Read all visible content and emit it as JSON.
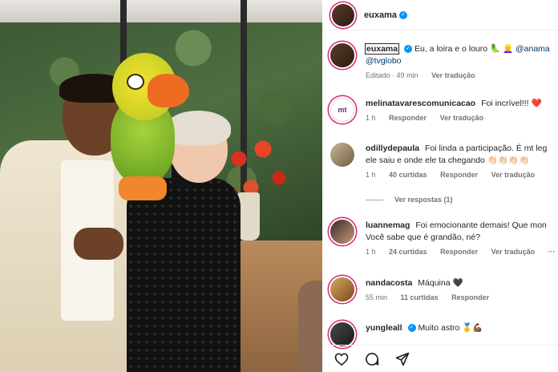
{
  "post": {
    "author": "euxama",
    "verified": true
  },
  "caption": {
    "username": "euxama",
    "text": "Eu, a loira e o louro 🦜 👱‍♀️",
    "mention_1": "@anama",
    "mention_2": "@tvglobo",
    "edited": "Editado · 49 min",
    "translate": "Ver tradução"
  },
  "comments": [
    {
      "username": "melinatavarescomunicacao",
      "text": "Foi incrível!!! ❤️",
      "time": "1 h",
      "reply": "Responder",
      "translate": "Ver tradução",
      "avatar_text": "mt"
    },
    {
      "username": "odillydepaula",
      "text_line1": "Foi linda a participação. É mt leg",
      "text_line2": "ele saiu e onde ele ta chegando 👏🏻👏🏻👏🏻👏🏻",
      "time": "1 h",
      "likes": "40 curtidas",
      "reply": "Responder",
      "translate": "Ver tradução",
      "view_replies": "Ver respostas (1)"
    },
    {
      "username": "luannemag",
      "text_line1": "Foi emocionante demais! Que mon",
      "text_line2": "Você sabe que é grandão, né?",
      "time": "1 h",
      "likes": "24 curtidas",
      "reply": "Responder",
      "translate": "Ver tradução",
      "more": "···"
    },
    {
      "username": "nandacosta",
      "text": "Máquina 🖤",
      "time": "55 min",
      "likes": "11 curtidas",
      "reply": "Responder"
    },
    {
      "username": "yungleall",
      "text": "Muito astro 🥇💪🏾",
      "verified": true
    }
  ],
  "icons": [
    "heart-icon",
    "comment-icon",
    "share-icon"
  ]
}
